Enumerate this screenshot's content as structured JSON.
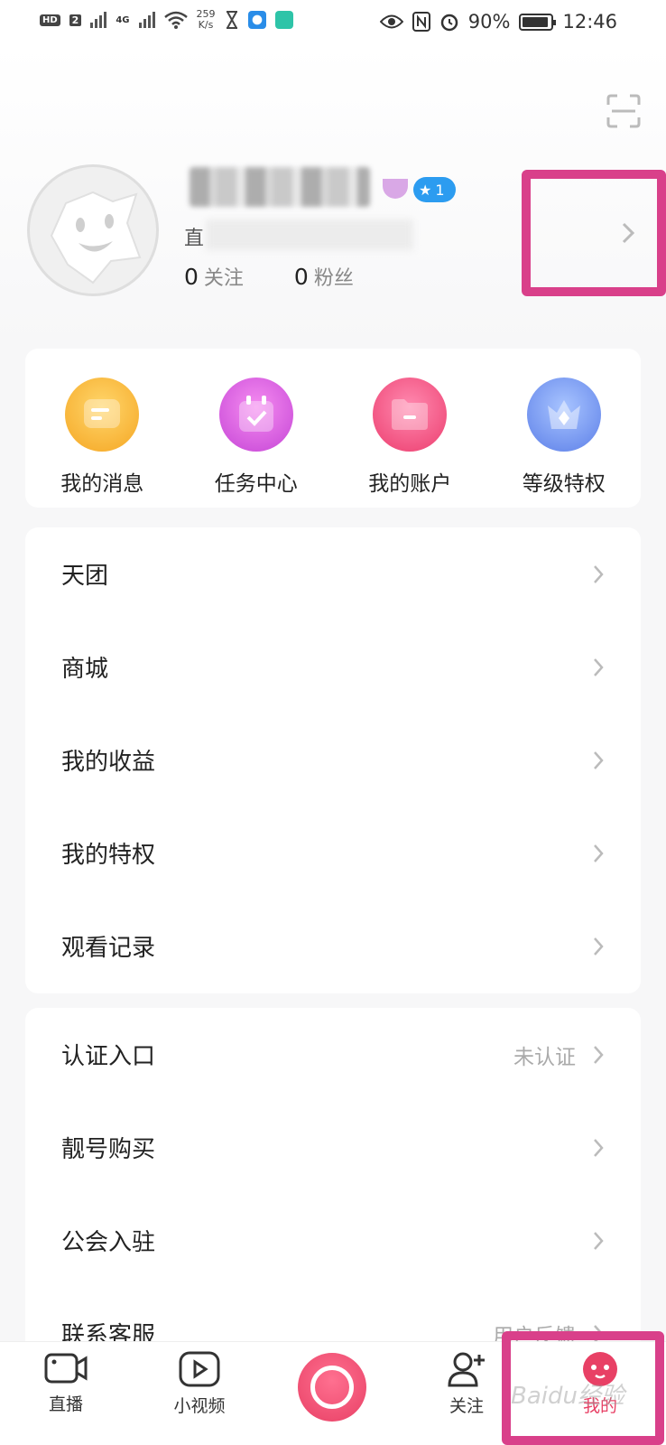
{
  "status_bar": {
    "hd": "HD",
    "sim": "2",
    "net": "4G",
    "speed_value": "259",
    "speed_unit": "K/s",
    "battery": "90%",
    "time": "12:46"
  },
  "profile": {
    "level": "1",
    "id_prefix": "直",
    "following_count": "0",
    "following_label": "关注",
    "fans_count": "0",
    "fans_label": "粉丝"
  },
  "quick_actions": [
    {
      "label": "我的消息",
      "icon": "message-icon",
      "color": "#f7b733"
    },
    {
      "label": "任务中心",
      "icon": "calendar-check-icon",
      "color": "#d158e0"
    },
    {
      "label": "我的账户",
      "icon": "folder-icon",
      "color": "#f0487a"
    },
    {
      "label": "等级特权",
      "icon": "crown-icon",
      "color": "#6c8ff0"
    }
  ],
  "menu_group1": [
    {
      "label": "天团"
    },
    {
      "label": "商城"
    },
    {
      "label": "我的收益"
    },
    {
      "label": "我的特权"
    },
    {
      "label": "观看记录"
    }
  ],
  "menu_group2": [
    {
      "label": "认证入口",
      "value": "未认证"
    },
    {
      "label": "靓号购买",
      "value": ""
    },
    {
      "label": "公会入驻",
      "value": ""
    },
    {
      "label": "联系客服",
      "value": "用户反馈"
    }
  ],
  "bottom_nav": [
    {
      "label": "直播",
      "icon": "live-camera-icon"
    },
    {
      "label": "小视频",
      "icon": "video-play-icon"
    },
    {
      "label": "",
      "icon": "record-button-icon"
    },
    {
      "label": "关注",
      "icon": "follow-user-icon"
    },
    {
      "label": "我的",
      "icon": "me-face-icon"
    }
  ],
  "watermark": "Baidu经验",
  "colors": {
    "accent": "#e84065",
    "highlight_box": "#d9408a",
    "level_badge": "#2c9cf0"
  }
}
